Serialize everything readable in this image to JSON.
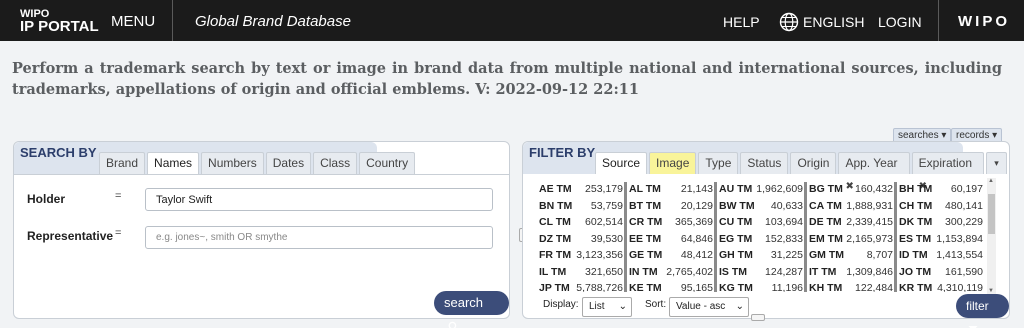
{
  "header": {
    "logo_line1": "WIPO",
    "logo_line2": "IP PORTAL",
    "menu": "MENU",
    "app_title": "Global Brand Database",
    "help": "HELP",
    "language": "ENGLISH",
    "login": "LOGIN",
    "brand": "WIPO"
  },
  "description": "Perform a trademark search by text or image in brand data from multiple national and international sources, including trademarks, appellations of origin and official emblems. V: 2022-09-12 22:11",
  "search_panel": {
    "title": "SEARCH BY",
    "tabs": [
      "Brand",
      "Names",
      "Numbers",
      "Dates",
      "Class",
      "Country"
    ],
    "active_tab": "Names",
    "holder_label": "Holder",
    "holder_eq": "=",
    "holder_value": "Taylor Swift",
    "rep_label": "Representative",
    "rep_eq": "=",
    "rep_placeholder": "e.g. jones~, smith OR smythe",
    "search_button": "search"
  },
  "filter_panel": {
    "title": "FILTER BY",
    "top_chips": [
      "searches",
      "records"
    ],
    "tabs": [
      "Source",
      "Image",
      "Type",
      "Status",
      "Origin",
      "App. Year",
      "Expiration"
    ],
    "active_tab": "Source",
    "highlight_tab": "Image",
    "closable_tabs": [
      "App. Year",
      "Expiration"
    ],
    "grid": [
      [
        [
          "AE TM",
          "253,179"
        ],
        [
          "AL TM",
          "21,143"
        ],
        [
          "AU TM",
          "1,962,609"
        ],
        [
          "BG TM",
          "160,432"
        ],
        [
          "BH TM",
          "60,197"
        ]
      ],
      [
        [
          "BN TM",
          "53,759"
        ],
        [
          "BT TM",
          "20,129"
        ],
        [
          "BW TM",
          "40,633"
        ],
        [
          "CA TM",
          "1,888,931"
        ],
        [
          "CH TM",
          "480,141"
        ]
      ],
      [
        [
          "CL TM",
          "602,514"
        ],
        [
          "CR TM",
          "365,369"
        ],
        [
          "CU TM",
          "103,694"
        ],
        [
          "DE TM",
          "2,339,415"
        ],
        [
          "DK TM",
          "300,229"
        ]
      ],
      [
        [
          "DZ TM",
          "39,530"
        ],
        [
          "EE TM",
          "64,846"
        ],
        [
          "EG TM",
          "152,833"
        ],
        [
          "EM TM",
          "2,165,973"
        ],
        [
          "ES TM",
          "1,153,894"
        ]
      ],
      [
        [
          "FR TM",
          "3,123,356"
        ],
        [
          "GE TM",
          "48,412"
        ],
        [
          "GH TM",
          "31,225"
        ],
        [
          "GM TM",
          "8,707"
        ],
        [
          "ID TM",
          "1,413,554"
        ]
      ],
      [
        [
          "IL TM",
          "321,650"
        ],
        [
          "IN TM",
          "2,765,402"
        ],
        [
          "IS TM",
          "124,287"
        ],
        [
          "IT TM",
          "1,309,846"
        ],
        [
          "JO TM",
          "161,590"
        ]
      ],
      [
        [
          "JP TM",
          "5,788,726"
        ],
        [
          "KE TM",
          "95,165"
        ],
        [
          "KG TM",
          "11,196"
        ],
        [
          "KH TM",
          "122,484"
        ],
        [
          "KR TM",
          "4,310,119"
        ]
      ]
    ],
    "display_label": "Display:",
    "display_value": "List",
    "sort_label": "Sort:",
    "sort_value": "Value - asc",
    "filter_button": "filter"
  },
  "colors": {
    "topbar": "#1b1b1b",
    "panel_header": "#dde4ee",
    "button": "#3c4d7a",
    "highlight": "#f9f49a"
  }
}
